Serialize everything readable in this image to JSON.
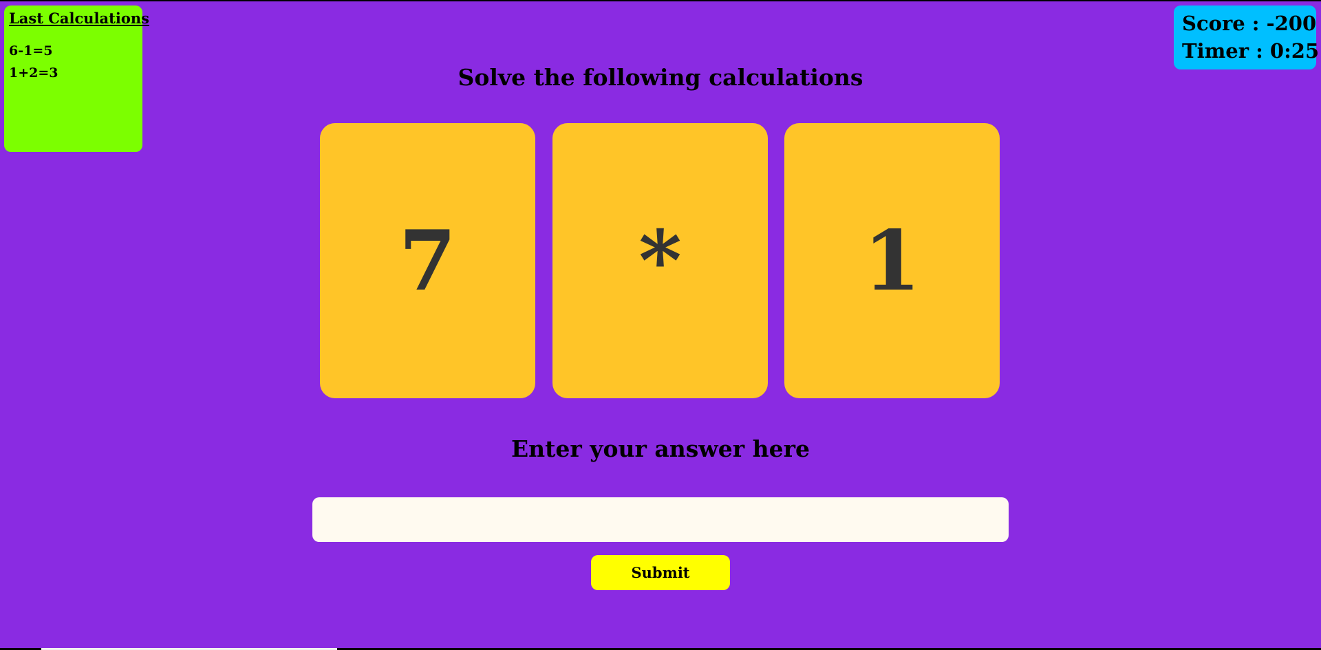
{
  "history": {
    "title": "Last Calculations",
    "items": [
      "6-1=5",
      "1+2=3"
    ]
  },
  "status": {
    "score": "Score : -200",
    "timer": "Timer : 0:25"
  },
  "main": {
    "heading": "Solve the following calculations",
    "cards": [
      "7",
      "*",
      "1"
    ]
  },
  "answer": {
    "heading": "Enter your answer here",
    "value": "",
    "placeholder": "",
    "submit_label": "Submit"
  },
  "colors": {
    "background": "#8a2be2",
    "history_panel": "#7cff00",
    "status_panel": "#00bfff",
    "card": "#ffc528",
    "card_text": "#333333",
    "input": "#fffaf0",
    "submit": "#ffff00"
  }
}
